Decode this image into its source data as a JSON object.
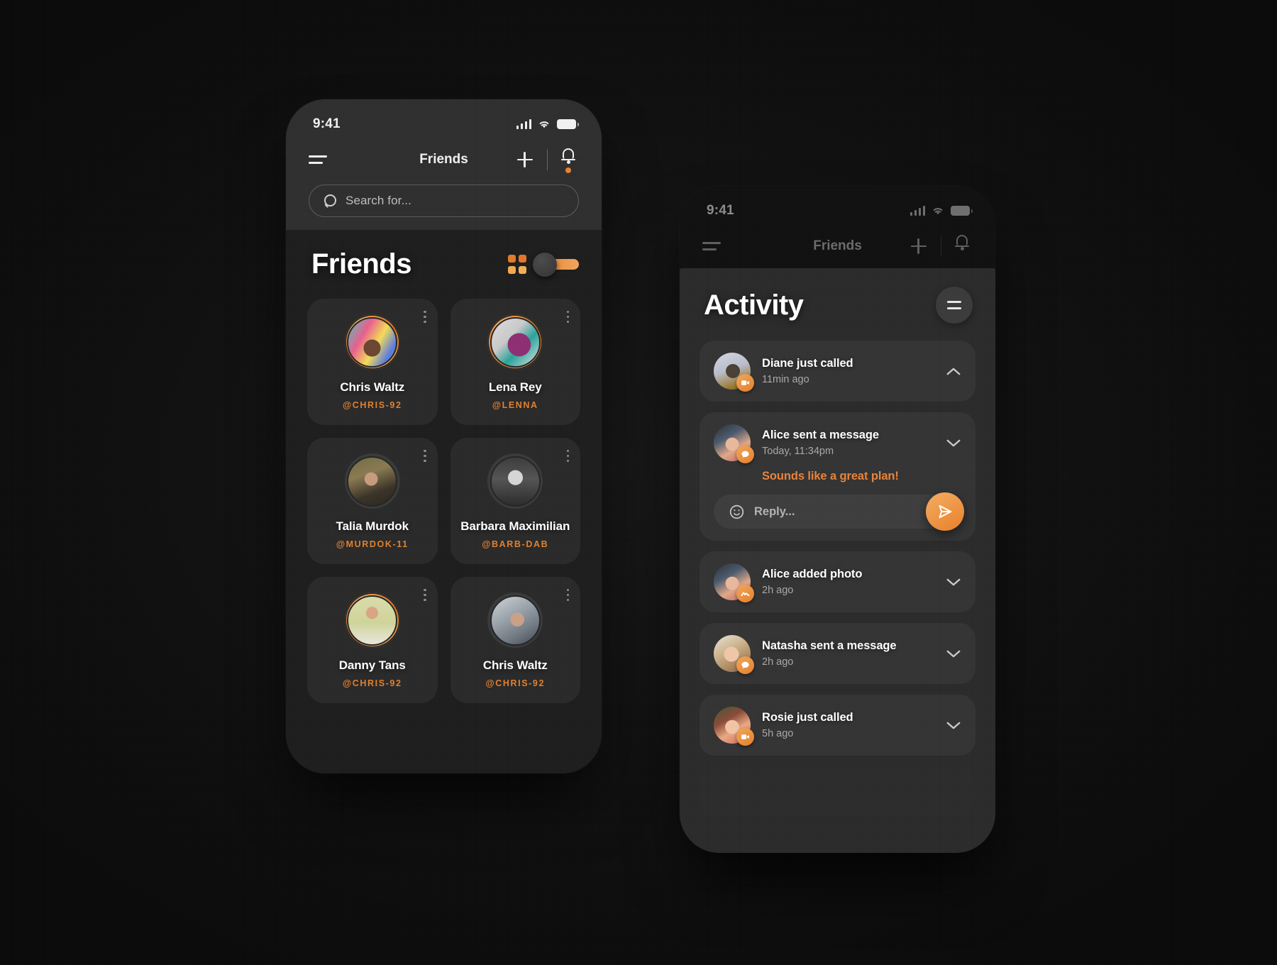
{
  "accent": {
    "orange": "#e8822e",
    "orange_light": "#f4ab60",
    "handle": "#e0802f",
    "message_text": "#e8833a"
  },
  "phone_friends": {
    "status": {
      "time": "9:41",
      "signal_icon": "cellular-bars-icon",
      "wifi_icon": "wifi-icon",
      "battery_icon": "battery-full-icon"
    },
    "nav": {
      "menu_icon": "hamburger-menu-icon",
      "title": "Friends",
      "add_icon": "plus-icon",
      "bell_icon": "bell-icon",
      "has_notification_dot": true
    },
    "search": {
      "icon": "search-icon",
      "placeholder": "Search for...",
      "value": ""
    },
    "section": {
      "title": "Friends",
      "grid_icon": "grid-view-icon",
      "toggle_icon": "view-toggle-switch",
      "toggle_on": true
    },
    "cards": [
      {
        "name": "Chris Waltz",
        "handle": "@CHRIS-92",
        "avatar": "av-chris",
        "ring": true,
        "menu_icon": "kebab-menu-icon"
      },
      {
        "name": "Lena Rey",
        "handle": "@LENNA",
        "avatar": "av-lena",
        "ring": true,
        "menu_icon": "kebab-menu-icon"
      },
      {
        "name": "Talia Murdok",
        "handle": "@MURDOK-11",
        "avatar": "av-talia",
        "ring": false,
        "menu_icon": "kebab-menu-icon"
      },
      {
        "name": "Barbara Maximilian",
        "handle": "@BARB-DAB",
        "avatar": "av-barbara",
        "ring": false,
        "menu_icon": "kebab-menu-icon"
      },
      {
        "name": "Danny Tans",
        "handle": "@CHRIS-92",
        "avatar": "av-danny",
        "ring": true,
        "menu_icon": "kebab-menu-icon"
      },
      {
        "name": "Chris Waltz",
        "handle": "@CHRIS-92",
        "avatar": "av-chrisw",
        "ring": false,
        "menu_icon": "kebab-menu-icon"
      }
    ]
  },
  "phone_activity": {
    "status": {
      "time": "9:41",
      "signal_icon": "cellular-bars-icon",
      "wifi_icon": "wifi-icon",
      "battery_icon": "battery-full-icon"
    },
    "nav": {
      "menu_icon": "hamburger-menu-icon",
      "title": "Friends",
      "add_icon": "plus-icon",
      "bell_icon": "bell-icon"
    },
    "section": {
      "title": "Activity",
      "filter_icon": "filter-lines-icon"
    },
    "items": [
      {
        "name": "Diane just called",
        "time": "11min ago",
        "avatar": "av-diane",
        "badge_icon": "video-camera-icon",
        "chevron_icon": "chevron-up-icon",
        "expanded": false
      },
      {
        "name": "Alice sent a message",
        "time": "Today, 11:34pm",
        "avatar": "av-alice",
        "badge_icon": "chat-bubble-icon",
        "chevron_icon": "chevron-down-icon",
        "expanded": true,
        "message": "Sounds like a great plan!",
        "reply": {
          "emoji_icon": "smiley-face-icon",
          "placeholder": "Reply...",
          "value": "",
          "send_icon": "send-paper-plane-icon"
        }
      },
      {
        "name": "Alice added photo",
        "time": "2h ago",
        "avatar": "av-alice",
        "badge_icon": "photo-mountain-icon",
        "chevron_icon": "chevron-down-icon",
        "expanded": false
      },
      {
        "name": "Natasha sent a message",
        "time": "2h ago",
        "avatar": "av-natasha",
        "badge_icon": "chat-bubble-icon",
        "chevron_icon": "chevron-down-icon",
        "expanded": false
      },
      {
        "name": "Rosie just called",
        "time": "5h ago",
        "avatar": "av-rosie",
        "badge_icon": "video-camera-icon",
        "chevron_icon": "chevron-down-icon",
        "expanded": false
      }
    ]
  }
}
